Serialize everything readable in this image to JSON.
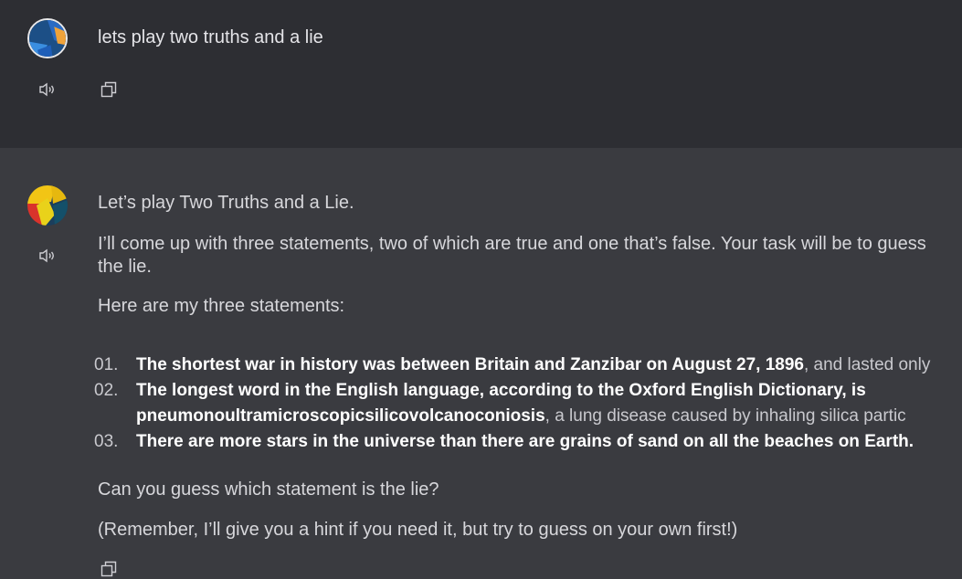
{
  "conversation": {
    "user_message": {
      "text": "lets play two truths and a lie",
      "icons": [
        "speaker-icon",
        "copy-icon"
      ]
    },
    "bot_message": {
      "intro": "Let’s play Two Truths and a Lie.",
      "explanation_line1": "I’ll come up with three statements, two of which are true and one that’s false. Your task will be to guess",
      "explanation_line2": "the lie.",
      "lead_in": "Here are my three statements:",
      "statements": [
        {
          "number": "01.",
          "bold": "The shortest war in history was between Britain and Zanzibar on August 27, 1896",
          "rest": ", and lasted only"
        },
        {
          "number": "02.",
          "bold": "The longest word in the English language, according to the Oxford English Dictionary, is",
          "bold2": "pneumonoultramicroscopicsilicovolcanoconiosis",
          "rest": ", a lung disease caused by inhaling silica partic"
        },
        {
          "number": "03.",
          "bold": "There are more stars in the universe than there are grains of sand on all the beaches on Earth.",
          "rest": ""
        }
      ],
      "question": "Can you guess which statement is the lie?",
      "reminder": "(Remember, I’ll give you a hint if you need it, but try to guess on your own first!)",
      "icons": [
        "speaker-icon",
        "copy-icon"
      ]
    }
  },
  "colors": {
    "user_bg": "#2d2e33",
    "bot_bg": "#3a3b40",
    "text": "#d7d7db",
    "bold_text": "#ffffff"
  }
}
